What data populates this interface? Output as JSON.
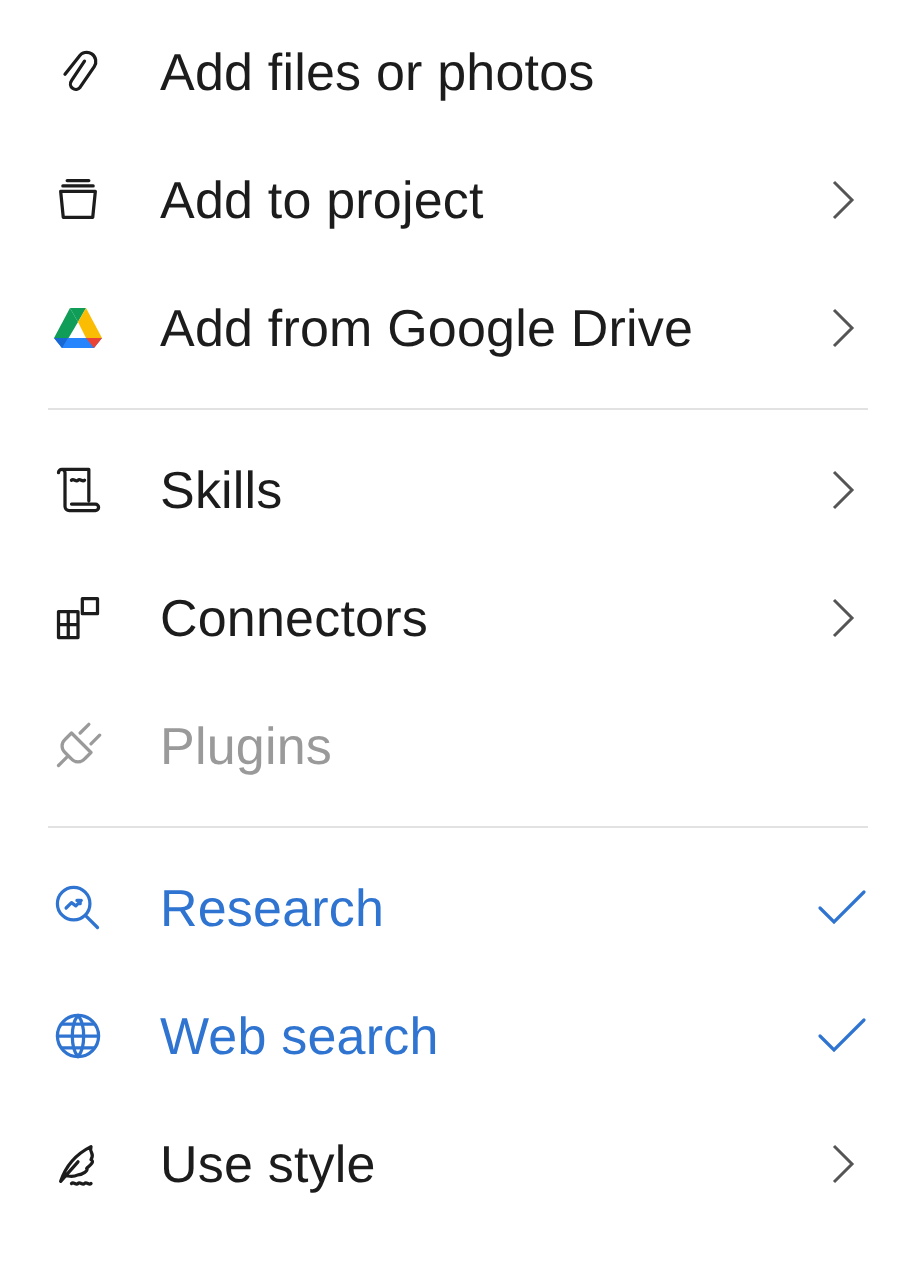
{
  "menu": {
    "sections": [
      {
        "items": [
          {
            "label": "Add files or photos",
            "kind": "action",
            "disabled": false
          },
          {
            "label": "Add to project",
            "kind": "submenu",
            "disabled": false
          },
          {
            "label": "Add from Google Drive",
            "kind": "submenu",
            "disabled": false
          }
        ]
      },
      {
        "items": [
          {
            "label": "Skills",
            "kind": "submenu",
            "disabled": false
          },
          {
            "label": "Connectors",
            "kind": "submenu",
            "disabled": false
          },
          {
            "label": "Plugins",
            "kind": "action",
            "disabled": true
          }
        ]
      },
      {
        "items": [
          {
            "label": "Research",
            "kind": "toggle",
            "on": true,
            "disabled": false
          },
          {
            "label": "Web search",
            "kind": "toggle",
            "on": true,
            "disabled": false
          },
          {
            "label": "Use style",
            "kind": "submenu",
            "disabled": false
          }
        ]
      }
    ]
  }
}
